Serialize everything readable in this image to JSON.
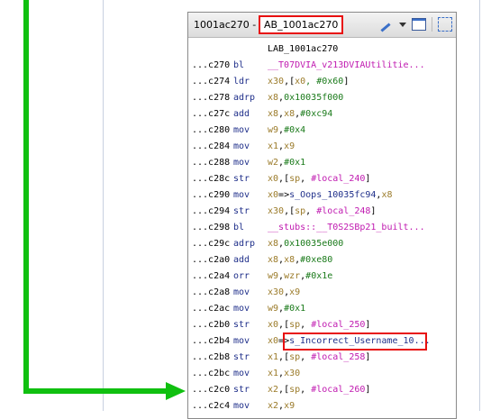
{
  "block": {
    "title_address": "1001ac270 -",
    "title_label": "AB_1001ac270"
  },
  "listing": {
    "label": "LAB_1001ac270",
    "rows": [
      {
        "addr": "...c270",
        "mn": "bl",
        "parts": [
          {
            "t": "__T07DVIA_v213DVIAUtilitie...",
            "c": "c-mag"
          }
        ]
      },
      {
        "addr": "...c274",
        "mn": "ldr",
        "parts": [
          {
            "t": "x30",
            "c": "c-reg"
          },
          {
            "t": ",[",
            "c": "c-blk"
          },
          {
            "t": "x0",
            "c": "c-reg"
          },
          {
            "t": ", #0x60",
            "c": "c-num"
          },
          {
            "t": "]",
            "c": "c-blk"
          }
        ]
      },
      {
        "addr": "...c278",
        "mn": "adrp",
        "parts": [
          {
            "t": "x8",
            "c": "c-reg"
          },
          {
            "t": ",",
            "c": "c-blk"
          },
          {
            "t": "0x10035f000",
            "c": "c-num"
          }
        ]
      },
      {
        "addr": "...c27c",
        "mn": "add",
        "parts": [
          {
            "t": "x8",
            "c": "c-reg"
          },
          {
            "t": ",",
            "c": "c-blk"
          },
          {
            "t": "x8",
            "c": "c-reg"
          },
          {
            "t": ",",
            "c": "c-blk"
          },
          {
            "t": "#0xc94",
            "c": "c-num"
          }
        ]
      },
      {
        "addr": "...c280",
        "mn": "mov",
        "parts": [
          {
            "t": "w9",
            "c": "c-reg"
          },
          {
            "t": ",",
            "c": "c-blk"
          },
          {
            "t": "#0x4",
            "c": "c-num"
          }
        ]
      },
      {
        "addr": "...c284",
        "mn": "mov",
        "parts": [
          {
            "t": "x1",
            "c": "c-reg"
          },
          {
            "t": ",",
            "c": "c-blk"
          },
          {
            "t": "x9",
            "c": "c-reg"
          }
        ]
      },
      {
        "addr": "...c288",
        "mn": "mov",
        "parts": [
          {
            "t": "w2",
            "c": "c-reg"
          },
          {
            "t": ",",
            "c": "c-blk"
          },
          {
            "t": "#0x1",
            "c": "c-num"
          }
        ]
      },
      {
        "addr": "...c28c",
        "mn": "str",
        "parts": [
          {
            "t": "x0",
            "c": "c-reg"
          },
          {
            "t": ",[",
            "c": "c-blk"
          },
          {
            "t": "sp",
            "c": "c-reg"
          },
          {
            "t": ", ",
            "c": "c-blk"
          },
          {
            "t": "#local_240",
            "c": "c-mag"
          },
          {
            "t": "]",
            "c": "c-blk"
          }
        ]
      },
      {
        "addr": "...c290",
        "mn": "mov",
        "parts": [
          {
            "t": "x0",
            "c": "c-reg"
          },
          {
            "t": "=>",
            "c": "c-blk"
          },
          {
            "t": "s_Oops_10035fc94",
            "c": "c-blue"
          },
          {
            "t": ",",
            "c": "c-blk"
          },
          {
            "t": "x8",
            "c": "c-reg"
          }
        ]
      },
      {
        "addr": "...c294",
        "mn": "str",
        "parts": [
          {
            "t": "x30",
            "c": "c-reg"
          },
          {
            "t": ",[",
            "c": "c-blk"
          },
          {
            "t": "sp",
            "c": "c-reg"
          },
          {
            "t": ", ",
            "c": "c-blk"
          },
          {
            "t": "#local_248",
            "c": "c-mag"
          },
          {
            "t": "]",
            "c": "c-blk"
          }
        ]
      },
      {
        "addr": "...c298",
        "mn": "bl",
        "parts": [
          {
            "t": "__stubs::__T0S2SBp21_built...",
            "c": "c-mag"
          }
        ]
      },
      {
        "addr": "...c29c",
        "mn": "adrp",
        "parts": [
          {
            "t": "x8",
            "c": "c-reg"
          },
          {
            "t": ",",
            "c": "c-blk"
          },
          {
            "t": "0x10035e000",
            "c": "c-num"
          }
        ]
      },
      {
        "addr": "...c2a0",
        "mn": "add",
        "parts": [
          {
            "t": "x8",
            "c": "c-reg"
          },
          {
            "t": ",",
            "c": "c-blk"
          },
          {
            "t": "x8",
            "c": "c-reg"
          },
          {
            "t": ",",
            "c": "c-blk"
          },
          {
            "t": "#0xe80",
            "c": "c-num"
          }
        ]
      },
      {
        "addr": "...c2a4",
        "mn": "orr",
        "parts": [
          {
            "t": "w9",
            "c": "c-reg"
          },
          {
            "t": ",",
            "c": "c-blk"
          },
          {
            "t": "wzr",
            "c": "c-reg"
          },
          {
            "t": ",",
            "c": "c-blk"
          },
          {
            "t": "#0x1e",
            "c": "c-num"
          }
        ]
      },
      {
        "addr": "...c2a8",
        "mn": "mov",
        "parts": [
          {
            "t": "x30",
            "c": "c-reg"
          },
          {
            "t": ",",
            "c": "c-blk"
          },
          {
            "t": "x9",
            "c": "c-reg"
          }
        ]
      },
      {
        "addr": "...c2ac",
        "mn": "mov",
        "parts": [
          {
            "t": "w9",
            "c": "c-reg"
          },
          {
            "t": ",",
            "c": "c-blk"
          },
          {
            "t": "#0x1",
            "c": "c-num"
          }
        ]
      },
      {
        "addr": "...c2b0",
        "mn": "str",
        "parts": [
          {
            "t": "x0",
            "c": "c-reg"
          },
          {
            "t": ",[",
            "c": "c-blk"
          },
          {
            "t": "sp",
            "c": "c-reg"
          },
          {
            "t": ", ",
            "c": "c-blk"
          },
          {
            "t": "#local_250",
            "c": "c-mag"
          },
          {
            "t": "]",
            "c": "c-blk"
          }
        ]
      },
      {
        "addr": "...c2b4",
        "mn": "mov",
        "highlight": true,
        "parts": [
          {
            "t": "x0",
            "c": "c-reg"
          },
          {
            "t": "=>",
            "c": "c-blk"
          },
          {
            "t": "s_Incorrect_Username_1",
            "c": "c-blue"
          },
          {
            "t": "0...",
            "c": "c-blue"
          }
        ]
      },
      {
        "addr": "...c2b8",
        "mn": "str",
        "parts": [
          {
            "t": "x1",
            "c": "c-reg"
          },
          {
            "t": ",[",
            "c": "c-blk"
          },
          {
            "t": "sp",
            "c": "c-reg"
          },
          {
            "t": ", ",
            "c": "c-blk"
          },
          {
            "t": "#local_258",
            "c": "c-mag"
          },
          {
            "t": "]",
            "c": "c-blk"
          }
        ]
      },
      {
        "addr": "...c2bc",
        "mn": "mov",
        "parts": [
          {
            "t": "x1",
            "c": "c-reg"
          },
          {
            "t": ",",
            "c": "c-blk"
          },
          {
            "t": "x30",
            "c": "c-reg"
          }
        ]
      },
      {
        "addr": "...c2c0",
        "mn": "str",
        "parts": [
          {
            "t": "x2",
            "c": "c-reg"
          },
          {
            "t": ",[",
            "c": "c-blk"
          },
          {
            "t": "sp",
            "c": "c-reg"
          },
          {
            "t": ", ",
            "c": "c-blk"
          },
          {
            "t": "#local_260",
            "c": "c-mag"
          },
          {
            "t": "]",
            "c": "c-blk"
          }
        ]
      },
      {
        "addr": "...c2c4",
        "mn": "mov",
        "parts": [
          {
            "t": "x2",
            "c": "c-reg"
          },
          {
            "t": ",",
            "c": "c-blk"
          },
          {
            "t": "x9",
            "c": "c-reg"
          }
        ]
      }
    ]
  },
  "colors": {
    "flow_arrow": "#10c010",
    "highlight_box": "#e81010"
  },
  "icons": [
    "edit-icon",
    "dropdown-caret-icon",
    "window-icon",
    "snapshot-icon"
  ]
}
